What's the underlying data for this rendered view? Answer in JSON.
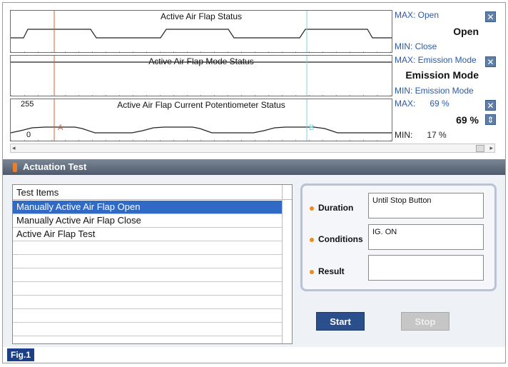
{
  "graphs": [
    {
      "title": "Active Air Flap Status",
      "max_label": "MAX: Open",
      "min_label": "MIN: Close",
      "current": "Open"
    },
    {
      "title": "Active Air Flap Mode Status",
      "max_label": "MAX: Emission Mode",
      "min_label": "MIN: Emission Mode",
      "current": "Emission Mode"
    },
    {
      "title": "Active Air Flap Current Potentiometer Status",
      "max_label": "MAX:",
      "max_value": "69 %",
      "min_label": "MIN:",
      "min_value": "17 %",
      "current": "69 %",
      "y_top_label": "255",
      "y_bottom_label": "0",
      "cursor_a_label": "A",
      "cursor_b_label": "B"
    }
  ],
  "close_icon_glyph": "✕",
  "updown_icon_glyph": "⇕",
  "actuation": {
    "header": "Actuation Test",
    "list_header": "Test Items",
    "items": [
      {
        "label": "Manually Active Air Flap Open",
        "selected": true
      },
      {
        "label": "Manually Active Air Flap Close",
        "selected": false
      },
      {
        "label": "Active Air Flap Test",
        "selected": false
      },
      {
        "label": "",
        "selected": false
      },
      {
        "label": "",
        "selected": false
      },
      {
        "label": "",
        "selected": false
      },
      {
        "label": "",
        "selected": false
      },
      {
        "label": "",
        "selected": false
      },
      {
        "label": "",
        "selected": false
      },
      {
        "label": "",
        "selected": false
      }
    ],
    "duration_label": "Duration",
    "duration_value": "Until Stop Button",
    "conditions_label": "Conditions",
    "conditions_value": "IG. ON",
    "result_label": "Result",
    "result_value": "",
    "start_label": "Start",
    "stop_label": "Stop"
  },
  "figure_label": "Fig.1",
  "colors": {
    "cursor_a": "#d9622b",
    "cursor_b": "#7fd3e0",
    "selected_row": "#316ac5",
    "start_button": "#2a4f8c",
    "header_bar": "#5a6576"
  }
}
